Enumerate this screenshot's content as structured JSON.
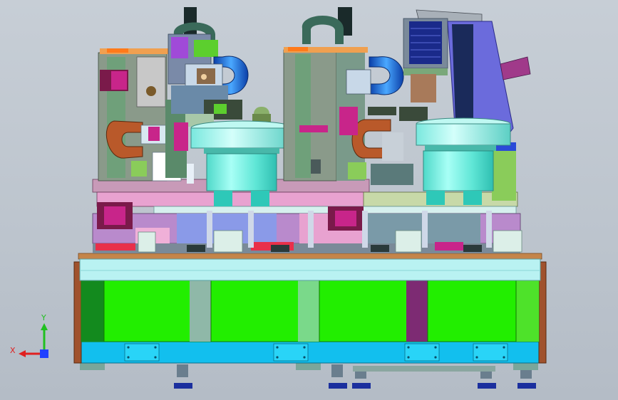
{
  "scene": {
    "background": "#bfc6cf",
    "colors": {
      "frame_green": "#22ee00",
      "frame_dark_green": "#138a1e",
      "base_cyan": "#12bfee",
      "rail_cyan": "#b9f2f2",
      "wood": "#a0522d",
      "bowl_cyan": "#6ff0e0",
      "bowl_dark": "#2ec8b8",
      "plate_pink": "#e8a2d0",
      "steel": "#6d7f8f",
      "magenta": "#c8258a",
      "blue_coil": "#1e6fd6",
      "copper": "#b9592a",
      "panel_violet": "#6b6bdc"
    }
  },
  "triad": {
    "x_label": "X",
    "y_label": "Y",
    "x_color": "#e02020",
    "y_color": "#20c020",
    "z_color": "#2040ff"
  }
}
